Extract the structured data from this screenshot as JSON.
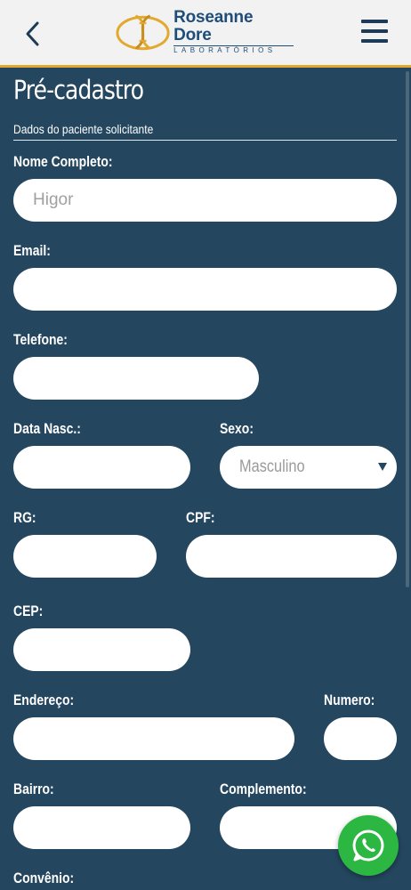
{
  "header": {
    "logo_name": "Roseanne Dore",
    "logo_sub": "LABORATÓRIOS"
  },
  "form": {
    "title": "Pré-cadastro",
    "section": "Dados do paciente solicitante",
    "nome_label": "Nome Completo:",
    "nome_placeholder": "Higor",
    "email_label": "Email:",
    "telefone_label": "Telefone:",
    "data_nasc_label": "Data Nasc.:",
    "sexo_label": "Sexo:",
    "sexo_value": "Masculino",
    "rg_label": "RG:",
    "cpf_label": "CPF:",
    "cep_label": "CEP:",
    "endereco_label": "Endereço:",
    "numero_label": "Numero:",
    "bairro_label": "Bairro:",
    "complemento_label": "Complemento:",
    "convenio_label": "Convênio:"
  },
  "colors": {
    "background": "#24465f",
    "accent": "#e3a92f",
    "whatsapp": "#2bb741"
  }
}
